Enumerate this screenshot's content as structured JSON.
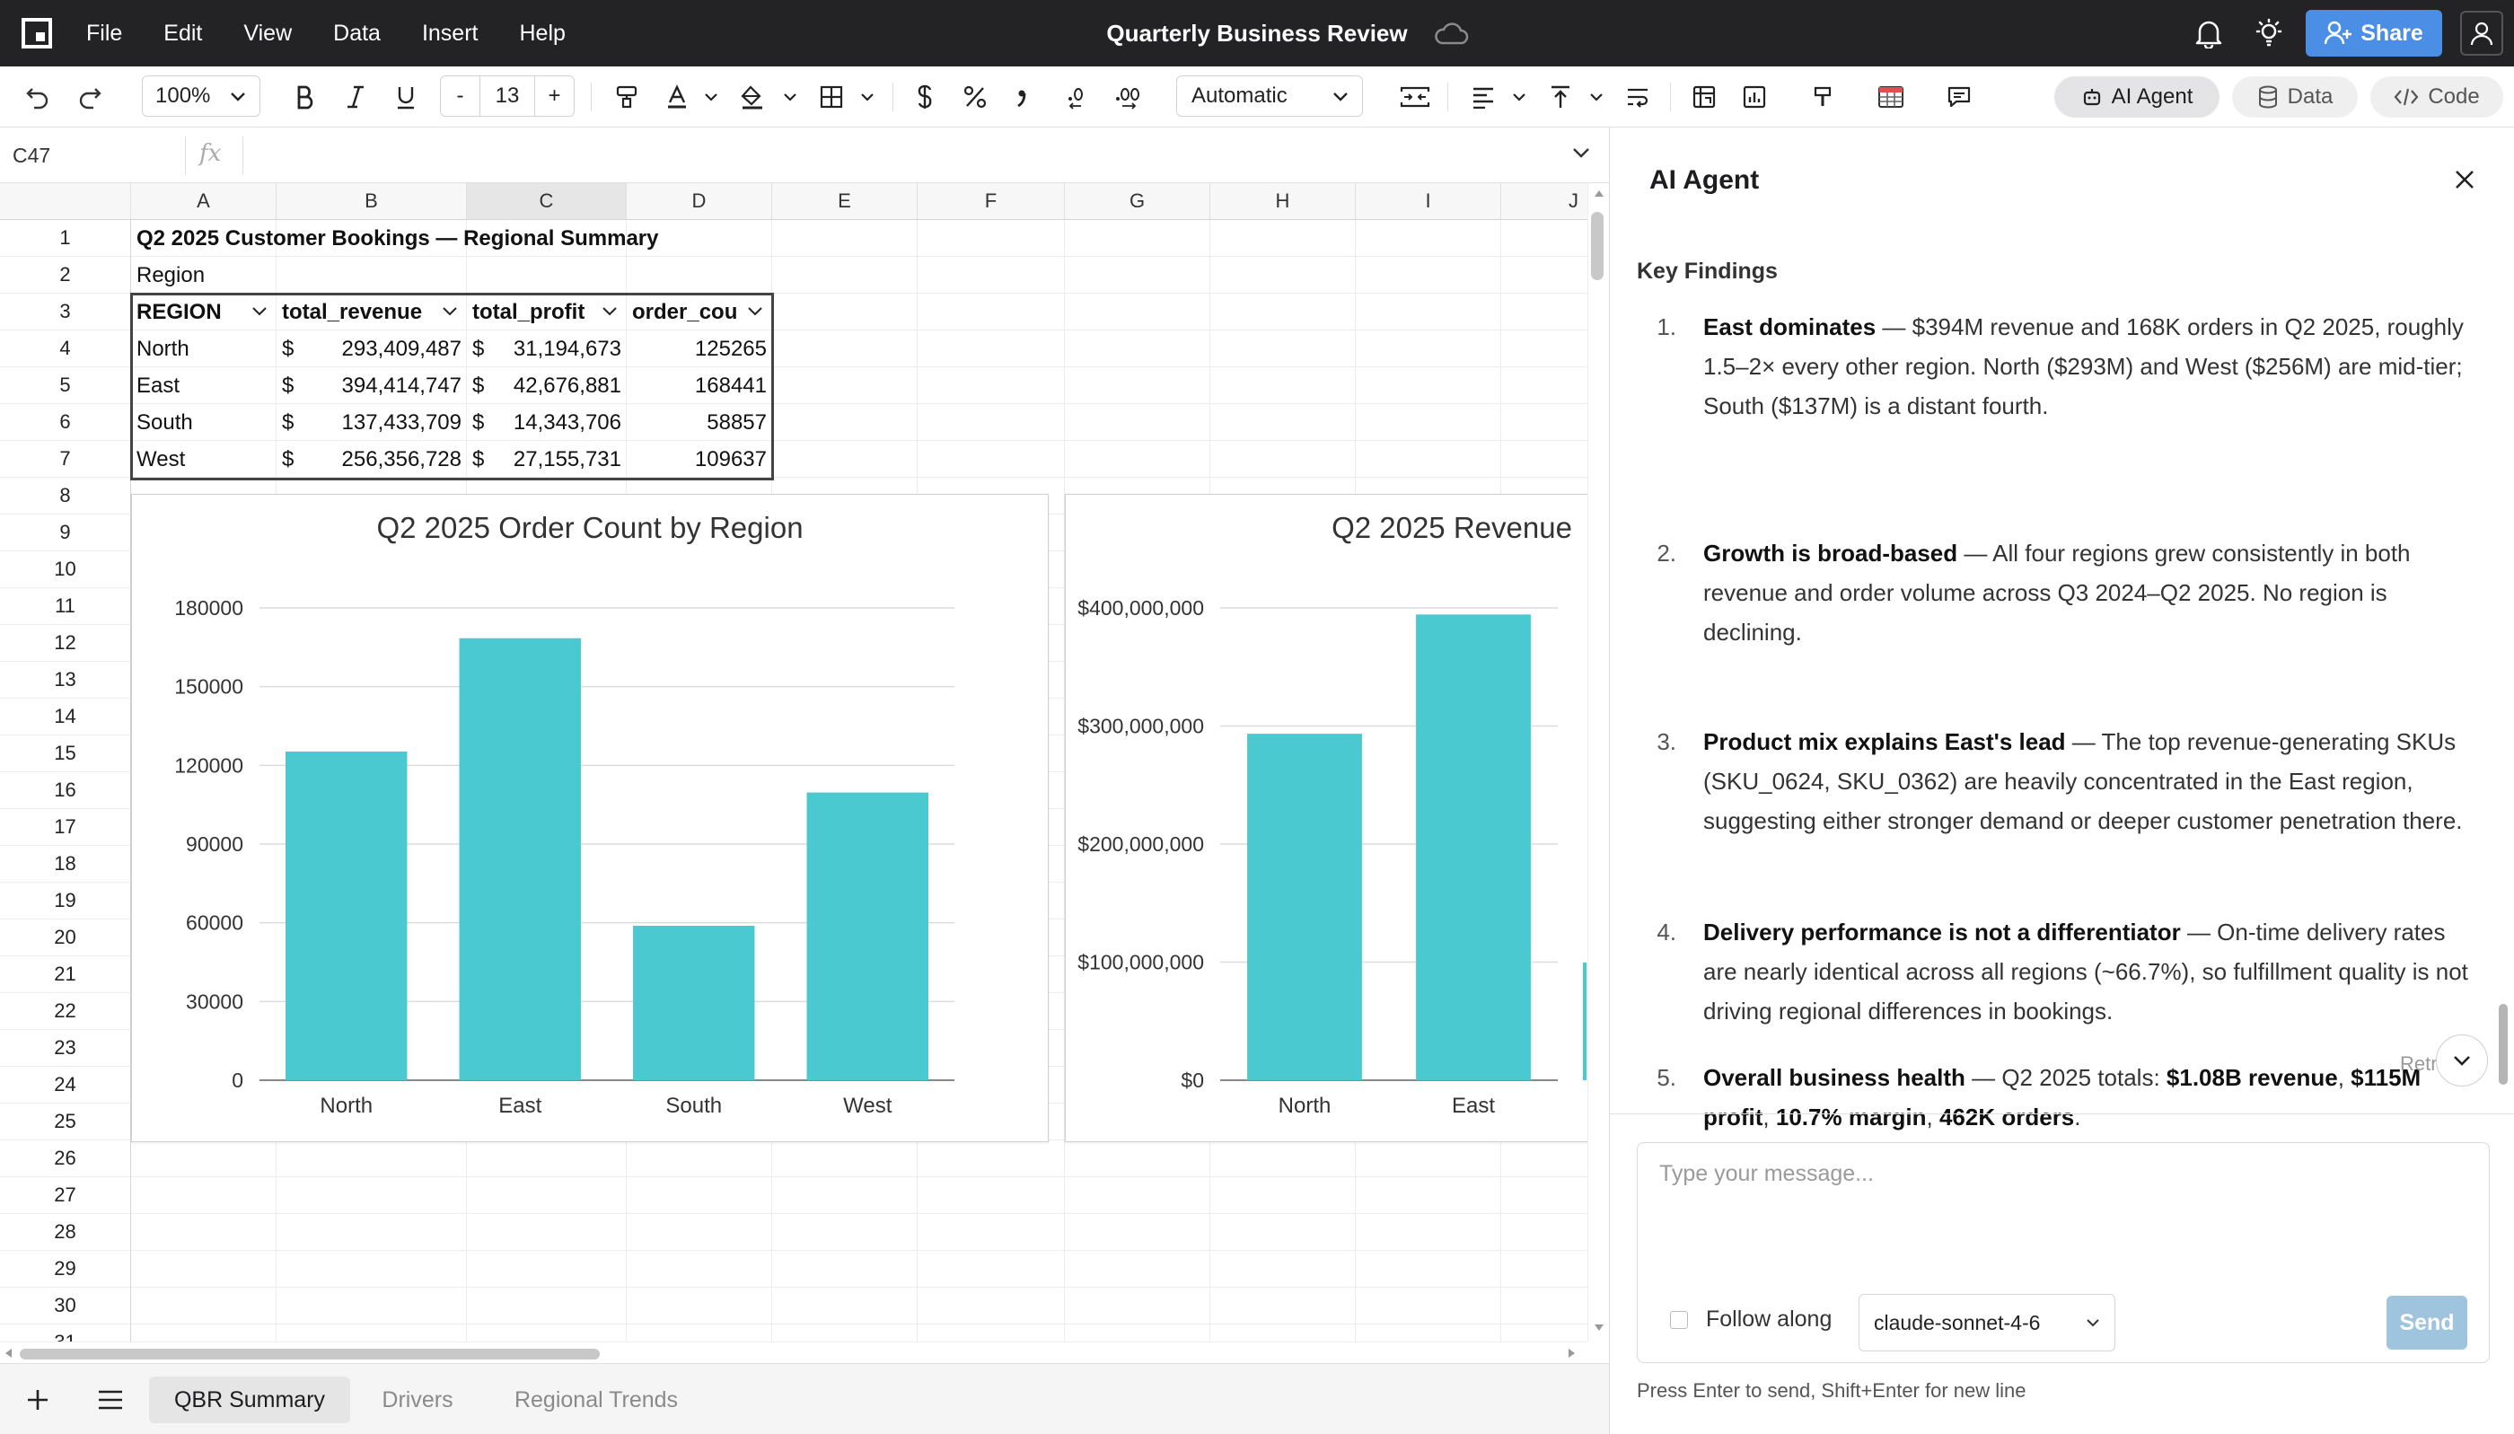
{
  "app": {
    "title": "Quarterly Business Review",
    "menu": [
      "File",
      "Edit",
      "View",
      "Data",
      "Insert",
      "Help"
    ],
    "share_label": "Share"
  },
  "toolbar": {
    "zoom": "100%",
    "font_size": "13",
    "minus": "-",
    "plus": "+",
    "number_format": "Automatic",
    "pills": [
      "AI Agent",
      "Data",
      "Code"
    ]
  },
  "formula_bar": {
    "cell_ref": "C47",
    "fx": "fx",
    "formula": ""
  },
  "grid": {
    "columns": [
      "A",
      "B",
      "C",
      "D",
      "E",
      "F",
      "G",
      "H",
      "I",
      "J"
    ],
    "selected_column": "C",
    "rows": [
      "1",
      "2",
      "3",
      "4",
      "5",
      "6",
      "7",
      "8",
      "9",
      "10",
      "11",
      "12",
      "13",
      "14",
      "15",
      "16",
      "17",
      "18",
      "19",
      "20",
      "21",
      "22",
      "23",
      "24",
      "25",
      "26",
      "27",
      "28",
      "29",
      "30",
      "31"
    ],
    "title": "Q2 2025 Customer Bookings — Regional Summary",
    "subtitle": "Region",
    "table_headers": [
      "REGION",
      "total_revenue",
      "total_profit",
      "order_cou"
    ],
    "currency": "$",
    "table_rows": [
      {
        "region": "North",
        "revenue": "293,409,487",
        "profit": "31,194,673",
        "orders": "125265"
      },
      {
        "region": "East",
        "revenue": "394,414,747",
        "profit": "42,676,881",
        "orders": "168441"
      },
      {
        "region": "South",
        "revenue": "137,433,709",
        "profit": "14,343,706",
        "orders": "58857"
      },
      {
        "region": "West",
        "revenue": "256,356,728",
        "profit": "27,155,731",
        "orders": "109637"
      }
    ]
  },
  "chart_data": [
    {
      "type": "bar",
      "title": "Q2 2025 Order Count by Region",
      "categories": [
        "North",
        "East",
        "South",
        "West"
      ],
      "values": [
        125265,
        168441,
        58857,
        109637
      ],
      "yticks": [
        "0",
        "30000",
        "60000",
        "90000",
        "120000",
        "150000",
        "180000"
      ],
      "ylim": [
        0,
        180000
      ],
      "grid": true,
      "color": "#4bc9d1"
    },
    {
      "type": "bar",
      "title": "Q2 2025 Revenue",
      "categories": [
        "North",
        "East"
      ],
      "values": [
        293409487,
        394414747
      ],
      "yticks": [
        "$0",
        "$100,000,000",
        "$200,000,000",
        "$300,000,000",
        "$400,000,000"
      ],
      "ylim": [
        0,
        400000000
      ],
      "grid": true,
      "color": "#4bc9d1"
    }
  ],
  "sheet_tabs": [
    "QBR Summary",
    "Drivers",
    "Regional Trends"
  ],
  "active_tab": "QBR Summary",
  "panel": {
    "title": "AI Agent",
    "section": "Key Findings",
    "retry": "Retr",
    "placeholder": "Type your message...",
    "follow_along": "Follow along",
    "model": "claude-sonnet-4-6",
    "send": "Send",
    "hint": "Press Enter to send, Shift+Enter for new line",
    "findings": [
      {
        "num": "1.",
        "segs": [
          {
            "text": "East dominates",
            "bold": true
          },
          {
            "text": " — $394M revenue and 168K orders in Q2 2025, roughly 1.5–2× every other region. North ($293M) and West ($256M) are mid-tier; South ($137M) is a distant fourth.",
            "bold": false
          }
        ]
      },
      {
        "num": "2.",
        "segs": [
          {
            "text": "Growth is broad-based",
            "bold": true
          },
          {
            "text": " — All four regions grew consistently in both revenue and order volume across Q3 2024–Q2 2025. No region is declining.",
            "bold": false
          }
        ]
      },
      {
        "num": "3.",
        "segs": [
          {
            "text": "Product mix explains East's lead",
            "bold": true
          },
          {
            "text": " — The top revenue-generating SKUs (SKU_0624, SKU_0362) are heavily concentrated in the East region, suggesting either stronger demand or deeper customer penetration there.",
            "bold": false
          }
        ]
      },
      {
        "num": "4.",
        "segs": [
          {
            "text": "Delivery performance is not a differentiator",
            "bold": true
          },
          {
            "text": " — On-time delivery rates are nearly identical across all regions (~66.7%), so fulfillment quality is not driving regional differences in bookings.",
            "bold": false
          }
        ]
      },
      {
        "num": "5.",
        "segs": [
          {
            "text": "Overall business health",
            "bold": true
          },
          {
            "text": " — Q2 2025 totals: ",
            "bold": false
          },
          {
            "text": "$1.08B revenue",
            "bold": true
          },
          {
            "text": ", ",
            "bold": false
          },
          {
            "text": "$115M profit",
            "bold": true
          },
          {
            "text": ", ",
            "bold": false
          },
          {
            "text": "10.7% margin",
            "bold": true
          },
          {
            "text": ", ",
            "bold": false
          },
          {
            "text": "462K orders",
            "bold": true
          },
          {
            "text": ".",
            "bold": false
          }
        ]
      }
    ]
  }
}
